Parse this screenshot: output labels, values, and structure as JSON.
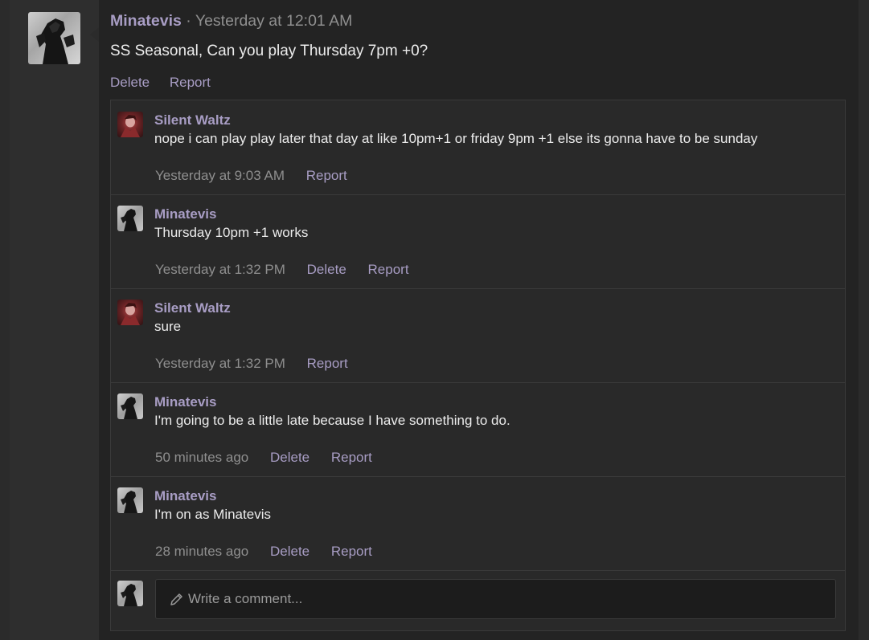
{
  "post": {
    "author": "Minatevis",
    "separator": "·",
    "timestamp": "Yesterday at 12:01 AM",
    "body": "SS Seasonal, Can you play Thursday 7pm +0?",
    "actions": {
      "delete": "Delete",
      "report": "Report"
    }
  },
  "comments": [
    {
      "author": "Silent Waltz",
      "avatar": "red-portrait-avatar",
      "text": "nope i can play play later that day at like 10pm+1 or friday 9pm +1 else its gonna have to be sunday",
      "time": "Yesterday at 9:03 AM",
      "actions": [
        "Report"
      ]
    },
    {
      "author": "Minatevis",
      "avatar": "dark-figure-avatar",
      "text": "Thursday 10pm +1 works",
      "time": "Yesterday at 1:32 PM",
      "actions": [
        "Delete",
        "Report"
      ]
    },
    {
      "author": "Silent Waltz",
      "avatar": "red-portrait-avatar",
      "text": "sure",
      "time": "Yesterday at 1:32 PM",
      "actions": [
        "Report"
      ]
    },
    {
      "author": "Minatevis",
      "avatar": "dark-figure-avatar",
      "text": "I'm going to be a little late because I have something to do.",
      "time": "50 minutes ago",
      "actions": [
        "Delete",
        "Report"
      ]
    },
    {
      "author": "Minatevis",
      "avatar": "dark-figure-avatar",
      "text": "I'm on as Minatevis",
      "time": "28 minutes ago",
      "actions": [
        "Delete",
        "Report"
      ]
    }
  ],
  "composer": {
    "placeholder": "Write a comment..."
  },
  "colors": {
    "link": "#a89dc4",
    "muted": "#8f8f8f",
    "text": "#ececec",
    "background": "#232323"
  }
}
